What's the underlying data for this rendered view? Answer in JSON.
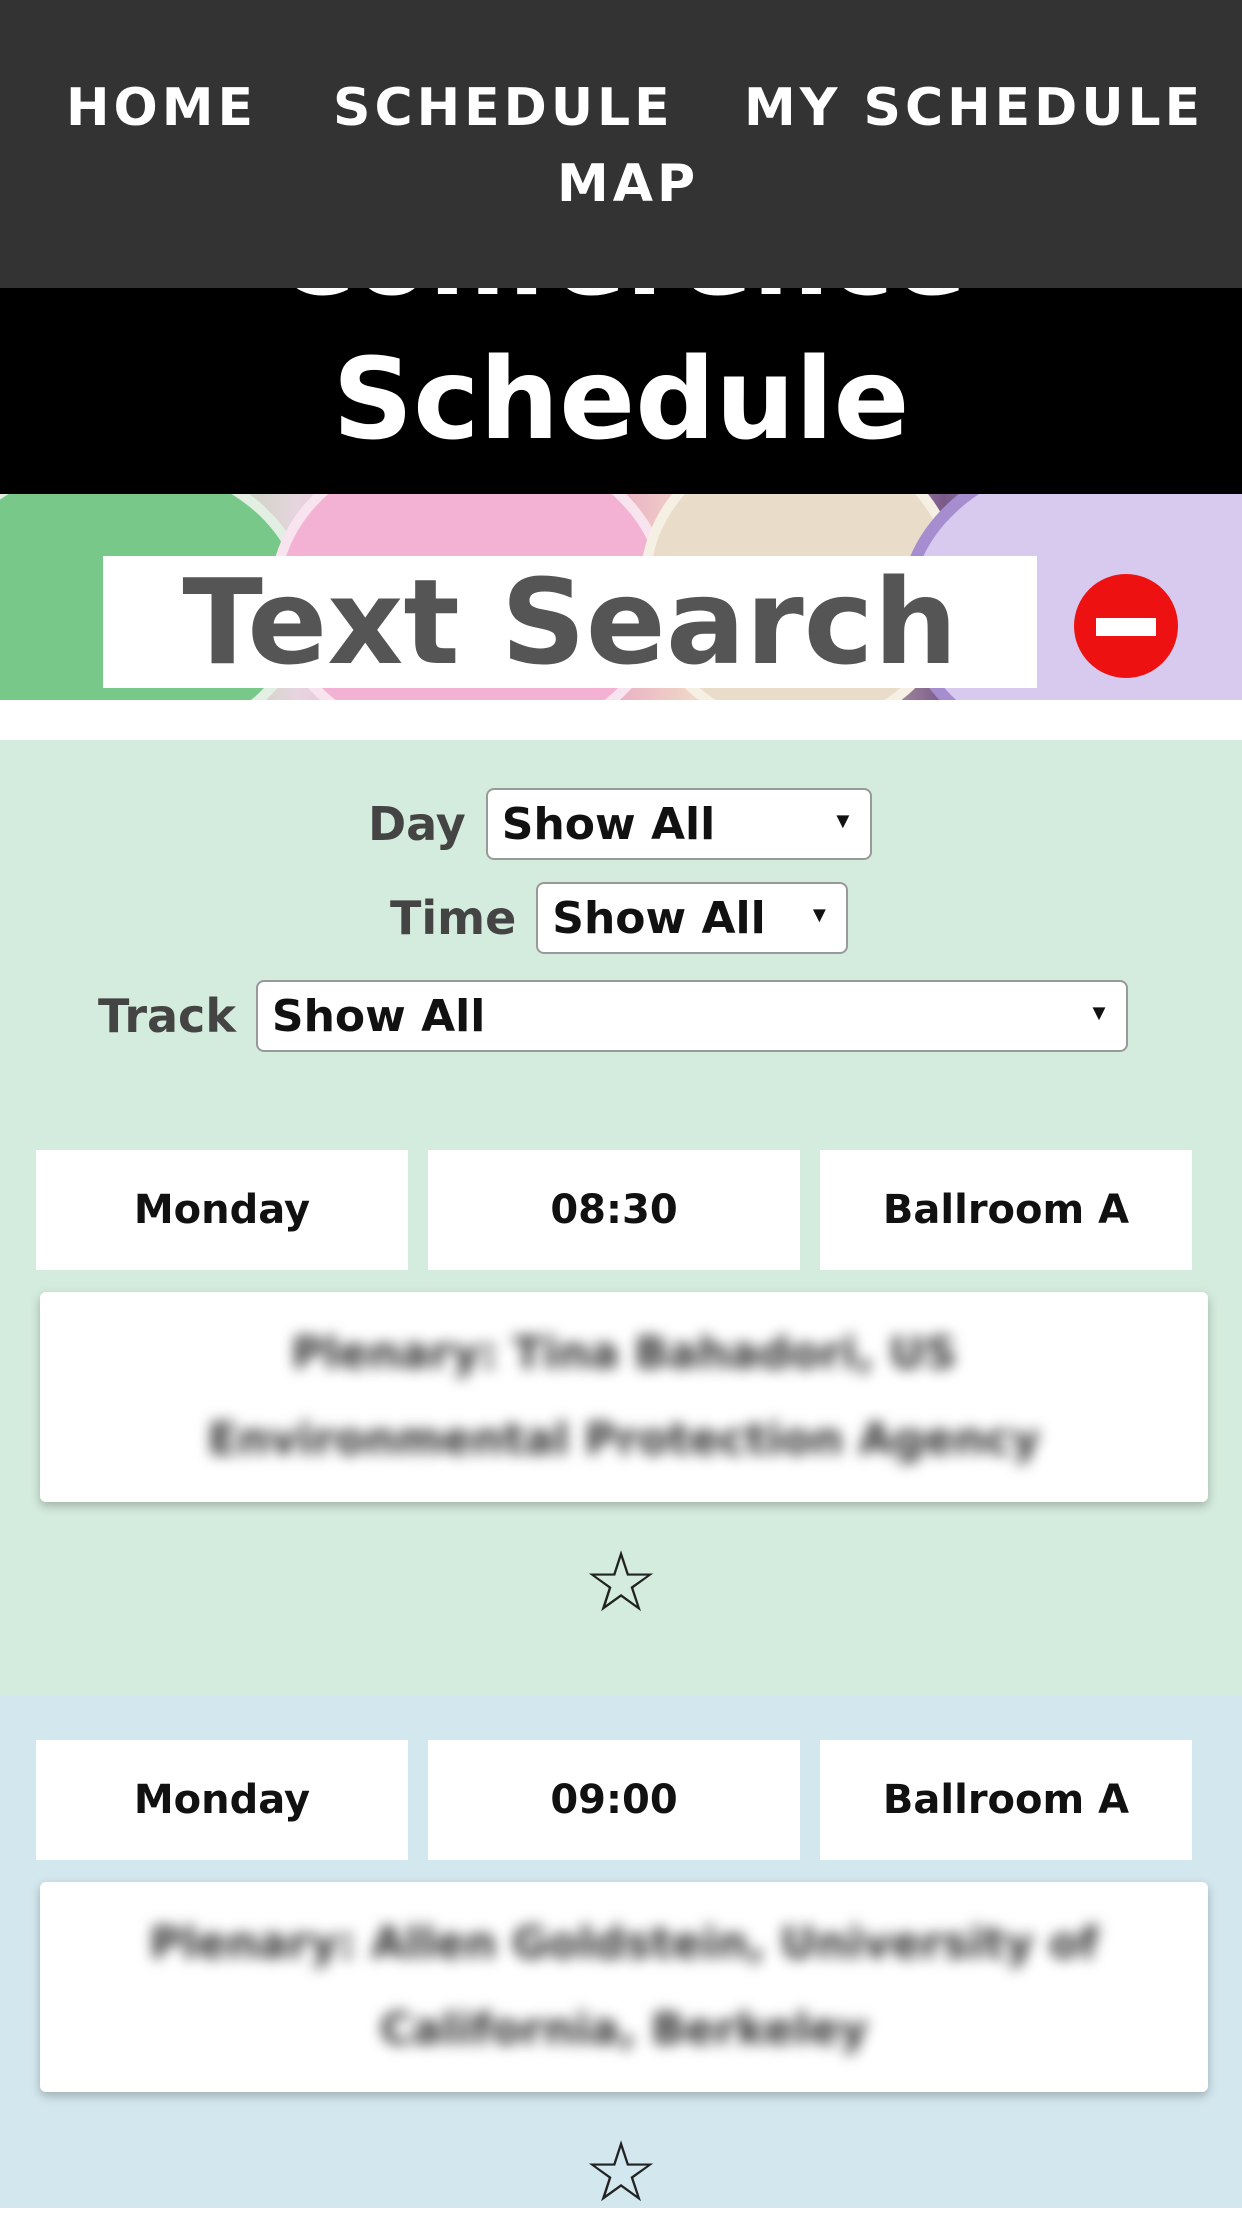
{
  "nav": {
    "items": [
      {
        "label": "HOME"
      },
      {
        "label": "SCHEDULE"
      },
      {
        "label": "MY SCHEDULE"
      },
      {
        "label": "MAP"
      }
    ]
  },
  "header": {
    "title_partial": "Conference",
    "title": "Schedule"
  },
  "search": {
    "label": "Text Search",
    "clear_icon": "no-entry-icon"
  },
  "filters": {
    "day": {
      "label": "Day",
      "selected": "Show All"
    },
    "time": {
      "label": "Time",
      "selected": "Show All"
    },
    "track": {
      "label": "Track",
      "selected": "Show All"
    }
  },
  "sessions": [
    {
      "day": "Monday",
      "time": "08:30",
      "room": "Ballroom A",
      "title": "Plenary: Tina Bahadori, US Environmental Protection Agency",
      "favorite_icon": "☆"
    },
    {
      "day": "Monday",
      "time": "09:00",
      "room": "Ballroom A",
      "title": "Plenary: Allen Goldstein, University of California, Berkeley",
      "favorite_icon": "☆"
    }
  ],
  "colors": {
    "nav_bg": "#333333",
    "filters_bg": "#d4ecdd",
    "session_alt_bg": "#d3e7ee",
    "clear_button": "#ee1111"
  }
}
